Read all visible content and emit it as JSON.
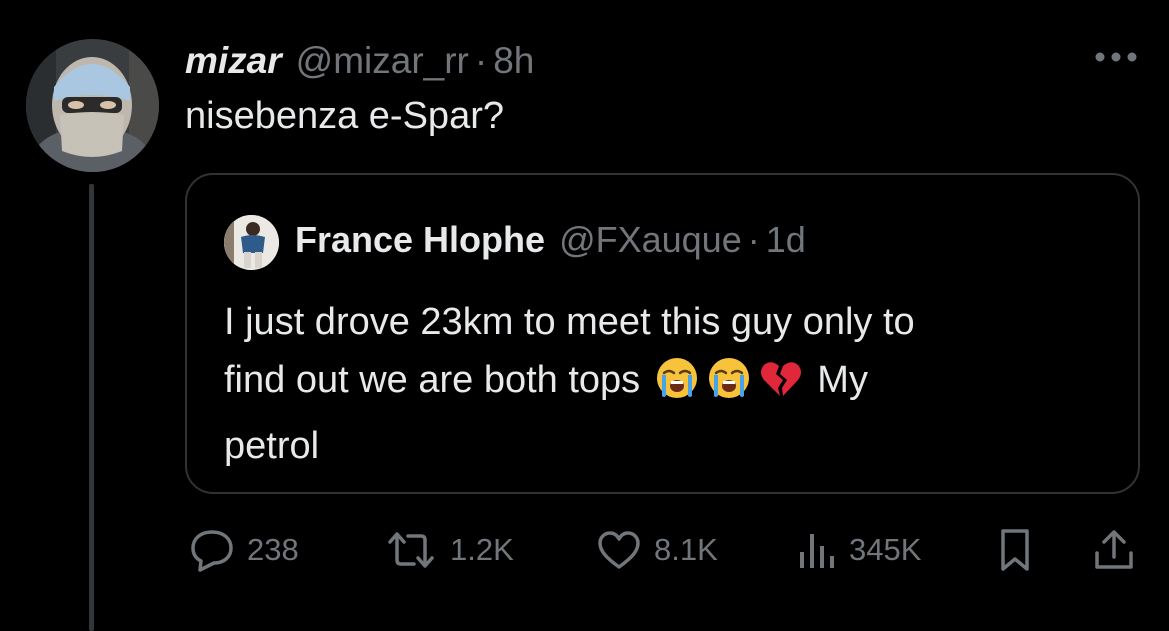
{
  "tweet": {
    "display_name": "mizar",
    "handle": "@mizar_rr",
    "separator": "·",
    "time": "8h",
    "text": "nisebenza e-Spar?",
    "more_icon": "more-dots-icon",
    "avatar": "avatar"
  },
  "quote": {
    "display_name": "France Hlophe",
    "handle": "@FXauque",
    "separator": "·",
    "time": "1d",
    "line1": "I just drove 23km to meet this guy only to",
    "line2_text": "find out we are both tops",
    "line2_after": "My",
    "line3": "petrol",
    "emojis": [
      "loudly-crying-face-icon",
      "loudly-crying-face-icon",
      "broken-heart-icon"
    ]
  },
  "actions": {
    "replies": "238",
    "reposts": "1.2K",
    "likes": "8.1K",
    "views": "345K",
    "icons": [
      "reply-icon",
      "repost-icon",
      "like-icon",
      "views-icon",
      "bookmark-icon",
      "share-icon"
    ]
  },
  "colors": {
    "background": "#000000",
    "primary_text": "#e7e9ea",
    "secondary_text": "#71767b",
    "border": "#2f3336"
  }
}
